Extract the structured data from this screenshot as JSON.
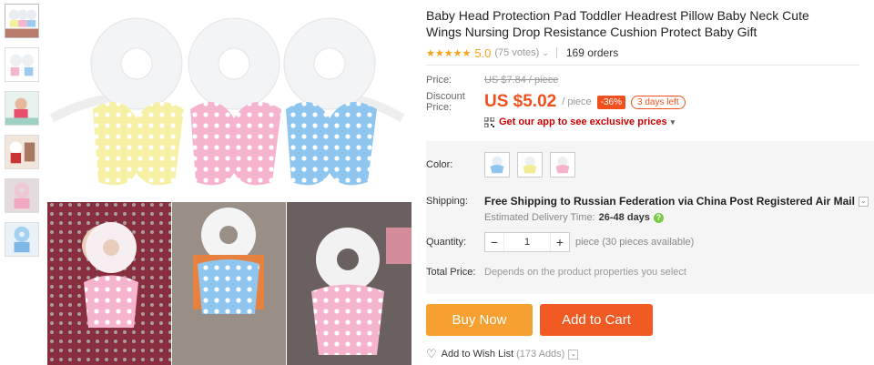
{
  "product": {
    "title": "Baby Head Protection Pad Toddler Headrest Pillow Baby Neck Cute Wings Nursing Drop Resistance Cushion Protect Baby Gift",
    "stars": "★★★★★",
    "rating": "5.0",
    "votes": "(75 votes)",
    "votes_chevron": "⌄",
    "orders": "169 orders"
  },
  "price": {
    "label": "Price:",
    "original": "US $7.84 / piece",
    "discount_label": "Discount Price:",
    "current": "US $5.02",
    "unit": "/ piece",
    "percent_off": "-36%",
    "days_left": "3 days left"
  },
  "app_promo": {
    "text": "Get our app to see exclusive prices",
    "chevron": "▾"
  },
  "color": {
    "label": "Color:",
    "options": [
      "blue",
      "yellow",
      "pink"
    ]
  },
  "shipping": {
    "label": "Shipping:",
    "text": "Free Shipping to Russian Federation via China Post Registered Air Mail",
    "chevron": "⌄",
    "estimate_label": "Estimated Delivery Time:",
    "estimate_value": "26-48 days",
    "help": "?"
  },
  "quantity": {
    "label": "Quantity:",
    "minus": "−",
    "value": "1",
    "plus": "+",
    "availability": "piece (30 pieces available)"
  },
  "total": {
    "label": "Total Price:",
    "value": "Depends on the product properties you select"
  },
  "actions": {
    "buy_now": "Buy Now",
    "add_to_cart": "Add to Cart",
    "wishlist": "Add to Wish List",
    "wishlist_count": "(173 Adds)",
    "wishlist_chevron": "⌄",
    "heart": "♡"
  },
  "colors": {
    "accent": "#f0501e",
    "buy": "#f7a032",
    "cart": "#f25a24",
    "star": "#f3a318",
    "app_red": "#cc0000"
  }
}
